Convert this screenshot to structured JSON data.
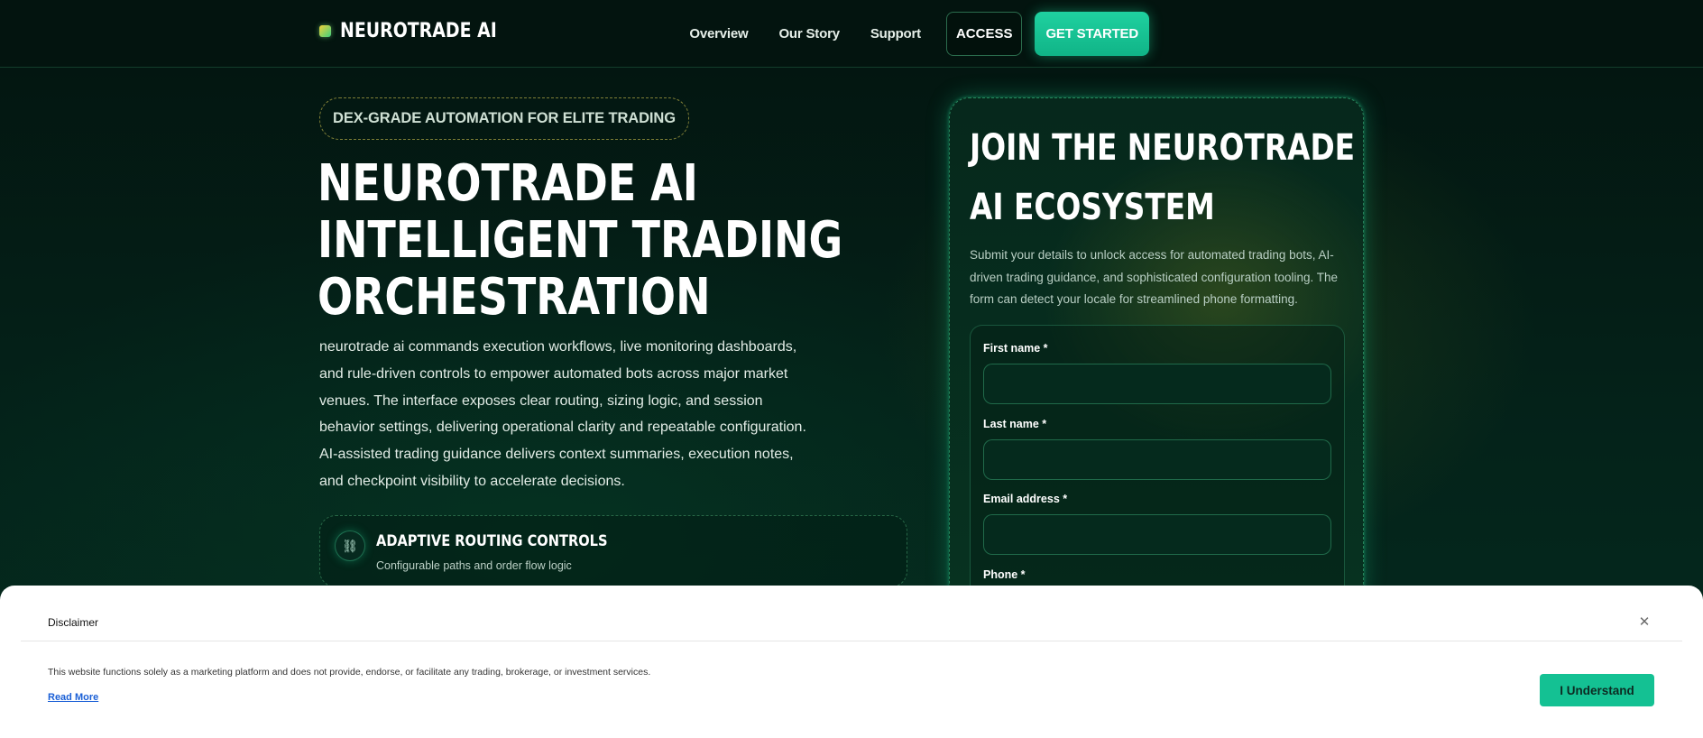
{
  "header": {
    "brand": "NEUROTRADE AI",
    "nav": [
      "Overview",
      "Our Story",
      "Support"
    ],
    "access_label": "ACCESS",
    "get_started_label": "GET STARTED"
  },
  "hero": {
    "badge": "DEX-GRADE AUTOMATION FOR ELITE TRADING",
    "title_lines": [
      "NEUROTRADE AI",
      "INTELLIGENT TRADING",
      "ORCHESTRATION"
    ],
    "description": "neurotrade ai commands execution workflows, live monitoring dashboards, and rule-driven controls to empower automated bots across major market venues. The interface exposes clear routing, sizing logic, and session behavior settings, delivering operational clarity and repeatable configuration. AI-assisted trading guidance delivers context summaries, execution notes, and checkpoint visibility to accelerate decisions.",
    "feature": {
      "icon": "link-icon",
      "glyph": "⛓",
      "title": "ADAPTIVE ROUTING CONTROLS",
      "subtitle": "Configurable paths and order flow logic"
    }
  },
  "join": {
    "title_lines": [
      "JOIN THE NEUROTRADE",
      "AI ECOSYSTEM"
    ],
    "description": "Submit your details to unlock access for automated trading bots, AI-driven trading guidance, and sophisticated configuration tooling. The form can detect your locale for streamlined phone formatting.",
    "fields": {
      "first_name": {
        "label": "First name *",
        "value": ""
      },
      "last_name": {
        "label": "Last name *",
        "value": ""
      },
      "email": {
        "label": "Email address *",
        "value": ""
      },
      "phone": {
        "label": "Phone *"
      }
    }
  },
  "disclaimer": {
    "title": "Disclaimer",
    "close_glyph": "✕",
    "text": "This website functions solely as a marketing platform and does not provide, endorse, or facilitate any trading, brokerage, or investment services.",
    "read_more": "Read More",
    "button": "I Understand"
  },
  "colors": {
    "background": "#041510",
    "accent": "#14c193",
    "card_border": "#3cbe82",
    "link": "#1a5fd6"
  }
}
